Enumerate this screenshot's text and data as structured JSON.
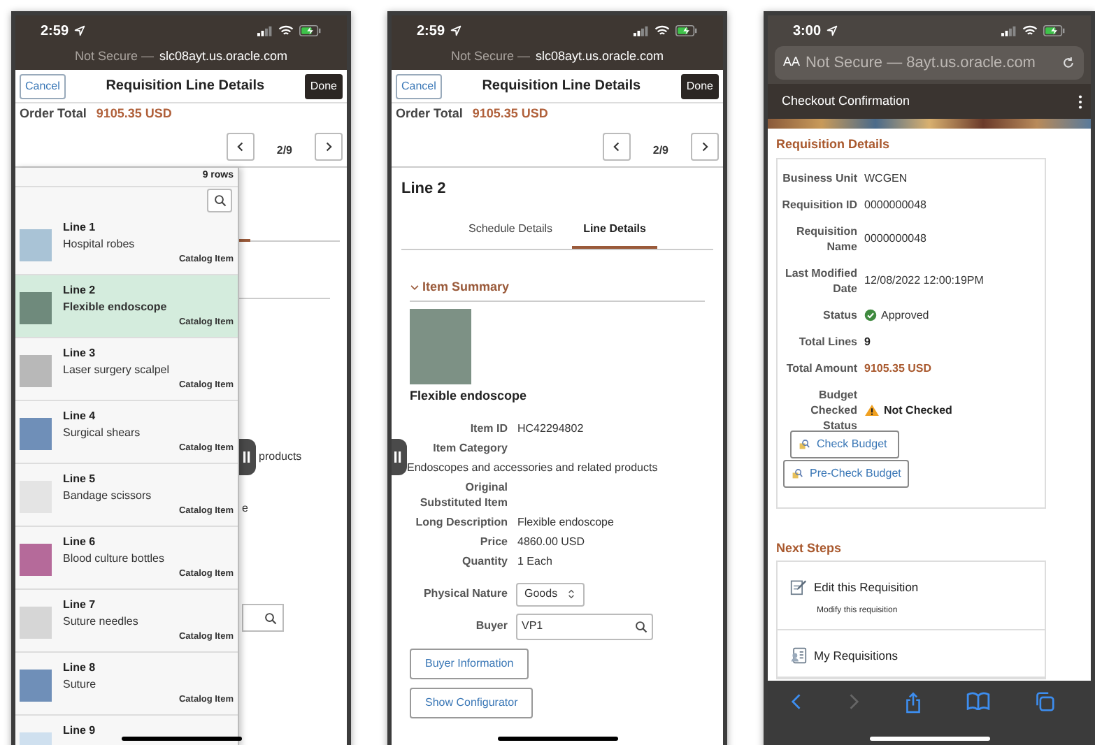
{
  "screens": [
    {
      "kind": "line_list",
      "status": {
        "time": "2:59"
      },
      "address": {
        "security": "Not Secure —",
        "host": "slc08ayt.us.oracle.com"
      },
      "header": {
        "cancel": "Cancel",
        "title": "Requisition Line Details",
        "done": "Done"
      },
      "order_total": {
        "label": "Order Total",
        "value": "9105.35 USD"
      },
      "pager": {
        "position": "2/9"
      },
      "behind_panel_texts": [
        "products",
        "e"
      ],
      "list": {
        "count_label": "9 rows",
        "rows": [
          {
            "title": "Line 1",
            "description": "Hospital robes",
            "type": "Catalog Item",
            "selected": false
          },
          {
            "title": "Line 2",
            "description": "Flexible endoscope",
            "type": "Catalog Item",
            "selected": true
          },
          {
            "title": "Line 3",
            "description": "Laser surgery scalpel",
            "type": "Catalog Item",
            "selected": false
          },
          {
            "title": "Line 4",
            "description": "Surgical shears",
            "type": "Catalog Item",
            "selected": false
          },
          {
            "title": "Line 5",
            "description": "Bandage scissors",
            "type": "Catalog Item",
            "selected": false
          },
          {
            "title": "Line 6",
            "description": "Blood culture bottles",
            "type": "Catalog Item",
            "selected": false
          },
          {
            "title": "Line 7",
            "description": "Suture needles",
            "type": "Catalog Item",
            "selected": false
          },
          {
            "title": "Line 8",
            "description": "Suture",
            "type": "Catalog Item",
            "selected": false
          },
          {
            "title": "Line 9",
            "selected": false
          }
        ]
      }
    },
    {
      "kind": "line_detail",
      "status": {
        "time": "2:59"
      },
      "address": {
        "security": "Not Secure —",
        "host": "slc08ayt.us.oracle.com"
      },
      "header": {
        "cancel": "Cancel",
        "title": "Requisition Line Details",
        "done": "Done"
      },
      "order_total": {
        "label": "Order Total",
        "value": "9105.35 USD"
      },
      "pager": {
        "position": "2/9"
      },
      "line_title": "Line 2",
      "tabs": [
        {
          "label": "Schedule Details",
          "selected": false
        },
        {
          "label": "Line Details",
          "selected": true
        }
      ],
      "section": {
        "title": "Item Summary",
        "expanded": true
      },
      "item_name": "Flexible endoscope",
      "fields": [
        {
          "kind": "inline",
          "label": "Item ID",
          "value": "HC42294802"
        },
        {
          "kind": "wrapped",
          "label": "Item Category",
          "value": "Endoscopes and accessories and related products"
        },
        {
          "kind": "inline",
          "label": "Original Substituted Item"
        },
        {
          "kind": "inline",
          "label": "Long Description",
          "value": "Flexible endoscope"
        },
        {
          "kind": "inline",
          "label": "Price",
          "value": "4860.00 USD"
        },
        {
          "kind": "inline",
          "label": "Quantity",
          "value": "1 Each"
        }
      ],
      "physical_nature": {
        "label": "Physical Nature",
        "value": "Goods"
      },
      "buyer": {
        "label": "Buyer",
        "value": "VP1"
      },
      "buttons": [
        "Buyer Information",
        "Show Configurator"
      ]
    },
    {
      "kind": "checkout",
      "status": {
        "time": "3:00"
      },
      "address": {
        "prefix": "AA",
        "text": "Not Secure — 8ayt.us.oracle.com"
      },
      "page_title": "Checkout Confirmation",
      "details": {
        "title": "Requisition Details",
        "fields": [
          {
            "kind": "text",
            "label": "Business Unit",
            "value": "WCGEN"
          },
          {
            "kind": "text",
            "label": "Requisition ID",
            "value": "0000000048"
          },
          {
            "kind": "text",
            "label": "Requisition Name",
            "value": "0000000048"
          },
          {
            "kind": "text",
            "label": "Last Modified Date",
            "value": "12/08/2022 12:00:19PM"
          },
          {
            "kind": "status",
            "label": "Status",
            "value": "Approved"
          },
          {
            "kind": "bold",
            "label": "Total Lines",
            "value": "9"
          },
          {
            "kind": "amount",
            "label": "Total Amount",
            "value": "9105.35 USD"
          },
          {
            "kind": "warning",
            "label": "Budget Checked Status",
            "value": "Not Checked"
          }
        ],
        "buttons": [
          "Check Budget",
          "Pre-Check Budget"
        ]
      },
      "next_steps": {
        "title": "Next Steps",
        "items": [
          {
            "title": "Edit this Requisition",
            "description": "Modify this requisition"
          },
          {
            "title": "My Requisitions"
          }
        ]
      }
    }
  ]
}
